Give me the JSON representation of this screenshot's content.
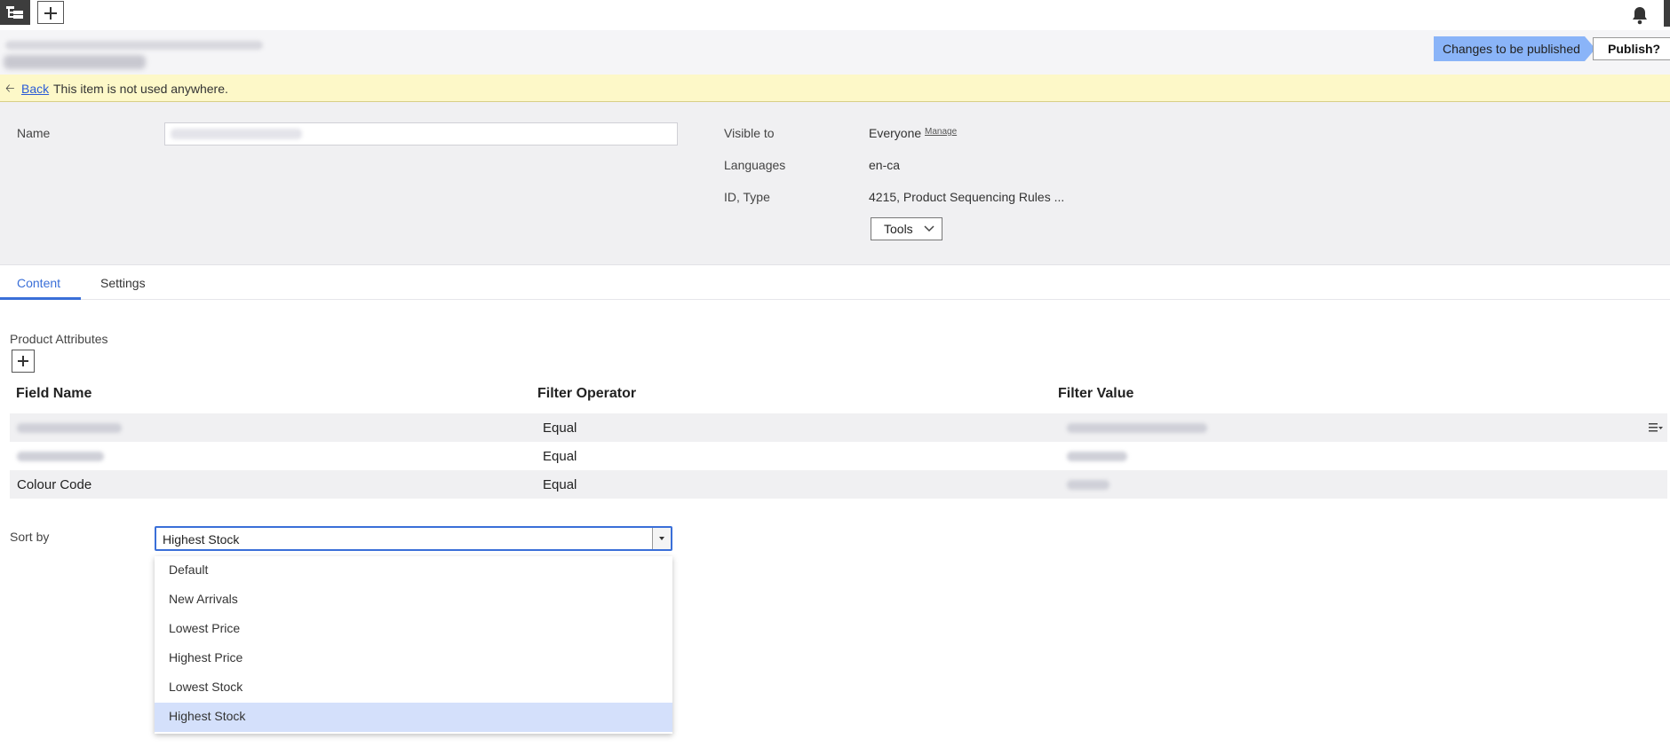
{
  "header": {
    "status_tag": "Changes to be published",
    "publish_label": "Publish?"
  },
  "notice": {
    "back_label": "Back",
    "message": "This item is not used anywhere."
  },
  "properties": {
    "name_label": "Name",
    "visible_to_label": "Visible to",
    "visible_to_value": "Everyone",
    "manage_label": "Manage",
    "languages_label": "Languages",
    "languages_value": "en-ca",
    "id_type_label": "ID, Type",
    "id_type_value": "4215, Product Sequencing Rules ...",
    "tools_label": "Tools"
  },
  "tabs": [
    {
      "label": "Content",
      "active": true
    },
    {
      "label": "Settings",
      "active": false
    }
  ],
  "content": {
    "section_label": "Product Attributes",
    "columns": [
      "Field Name",
      "Filter Operator",
      "Filter Value"
    ],
    "rows": [
      {
        "field": "",
        "operator": "Equal",
        "value": ""
      },
      {
        "field": "",
        "operator": "Equal",
        "value": ""
      },
      {
        "field": "Colour Code",
        "operator": "Equal",
        "value": ""
      }
    ]
  },
  "sort": {
    "label": "Sort by",
    "selected": "Highest Stock",
    "options": [
      "Default",
      "New Arrivals",
      "Lowest Price",
      "Highest Price",
      "Lowest Stock",
      "Highest Stock"
    ]
  },
  "colors": {
    "accent": "#3a6fd8",
    "publish_tag": "#8ab4f8",
    "notice_bg": "#fdf8c8",
    "selected_option": "#d4e0fb"
  }
}
